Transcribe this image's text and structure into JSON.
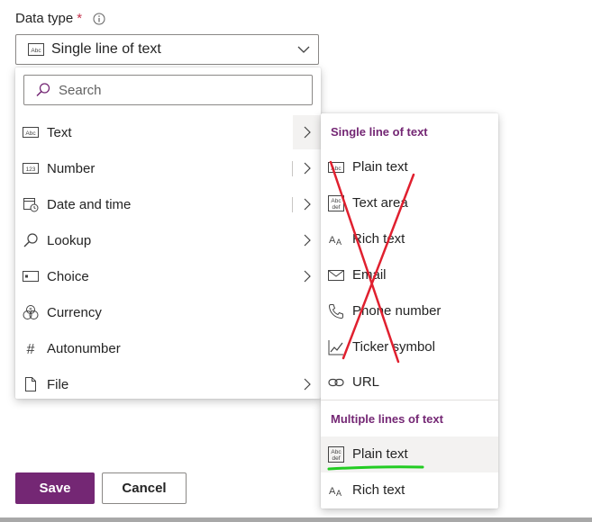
{
  "field": {
    "label": "Data type",
    "required_mark": "*"
  },
  "select": {
    "value": "Single line of text"
  },
  "search": {
    "placeholder": "Search"
  },
  "menu": {
    "items": [
      {
        "label": "Text",
        "icon": "abc-icon",
        "has_submenu": true,
        "active": true
      },
      {
        "label": "Number",
        "icon": "number-icon",
        "has_submenu": true
      },
      {
        "label": "Date and time",
        "icon": "calendar-clock-icon",
        "has_submenu": true
      },
      {
        "label": "Lookup",
        "icon": "search-icon",
        "has_submenu": true
      },
      {
        "label": "Choice",
        "icon": "choice-icon",
        "has_submenu": true
      },
      {
        "label": "Currency",
        "icon": "currency-icon",
        "has_submenu": false
      },
      {
        "label": "Autonumber",
        "icon": "hash-icon",
        "has_submenu": false
      },
      {
        "label": "File",
        "icon": "file-icon",
        "has_submenu": true
      }
    ]
  },
  "submenu": {
    "single_header": "Single line of text",
    "single_items": [
      {
        "label": "Plain text",
        "icon": "abc-icon"
      },
      {
        "label": "Text area",
        "icon": "abc-def-icon"
      },
      {
        "label": "Rich text",
        "icon": "rich-text-icon"
      },
      {
        "label": "Email",
        "icon": "mail-icon"
      },
      {
        "label": "Phone number",
        "icon": "phone-icon"
      },
      {
        "label": "Ticker symbol",
        "icon": "chart-icon"
      },
      {
        "label": "URL",
        "icon": "link-icon"
      }
    ],
    "multi_header": "Multiple lines of text",
    "multi_items": [
      {
        "label": "Plain text",
        "icon": "abc-def-icon",
        "highlighted": true
      },
      {
        "label": "Rich text",
        "icon": "rich-text-icon"
      }
    ]
  },
  "buttons": {
    "save": "Save",
    "cancel": "Cancel"
  },
  "colors": {
    "accent": "#742774",
    "red_mark": "#e0202f",
    "green_mark": "#22cc22"
  }
}
